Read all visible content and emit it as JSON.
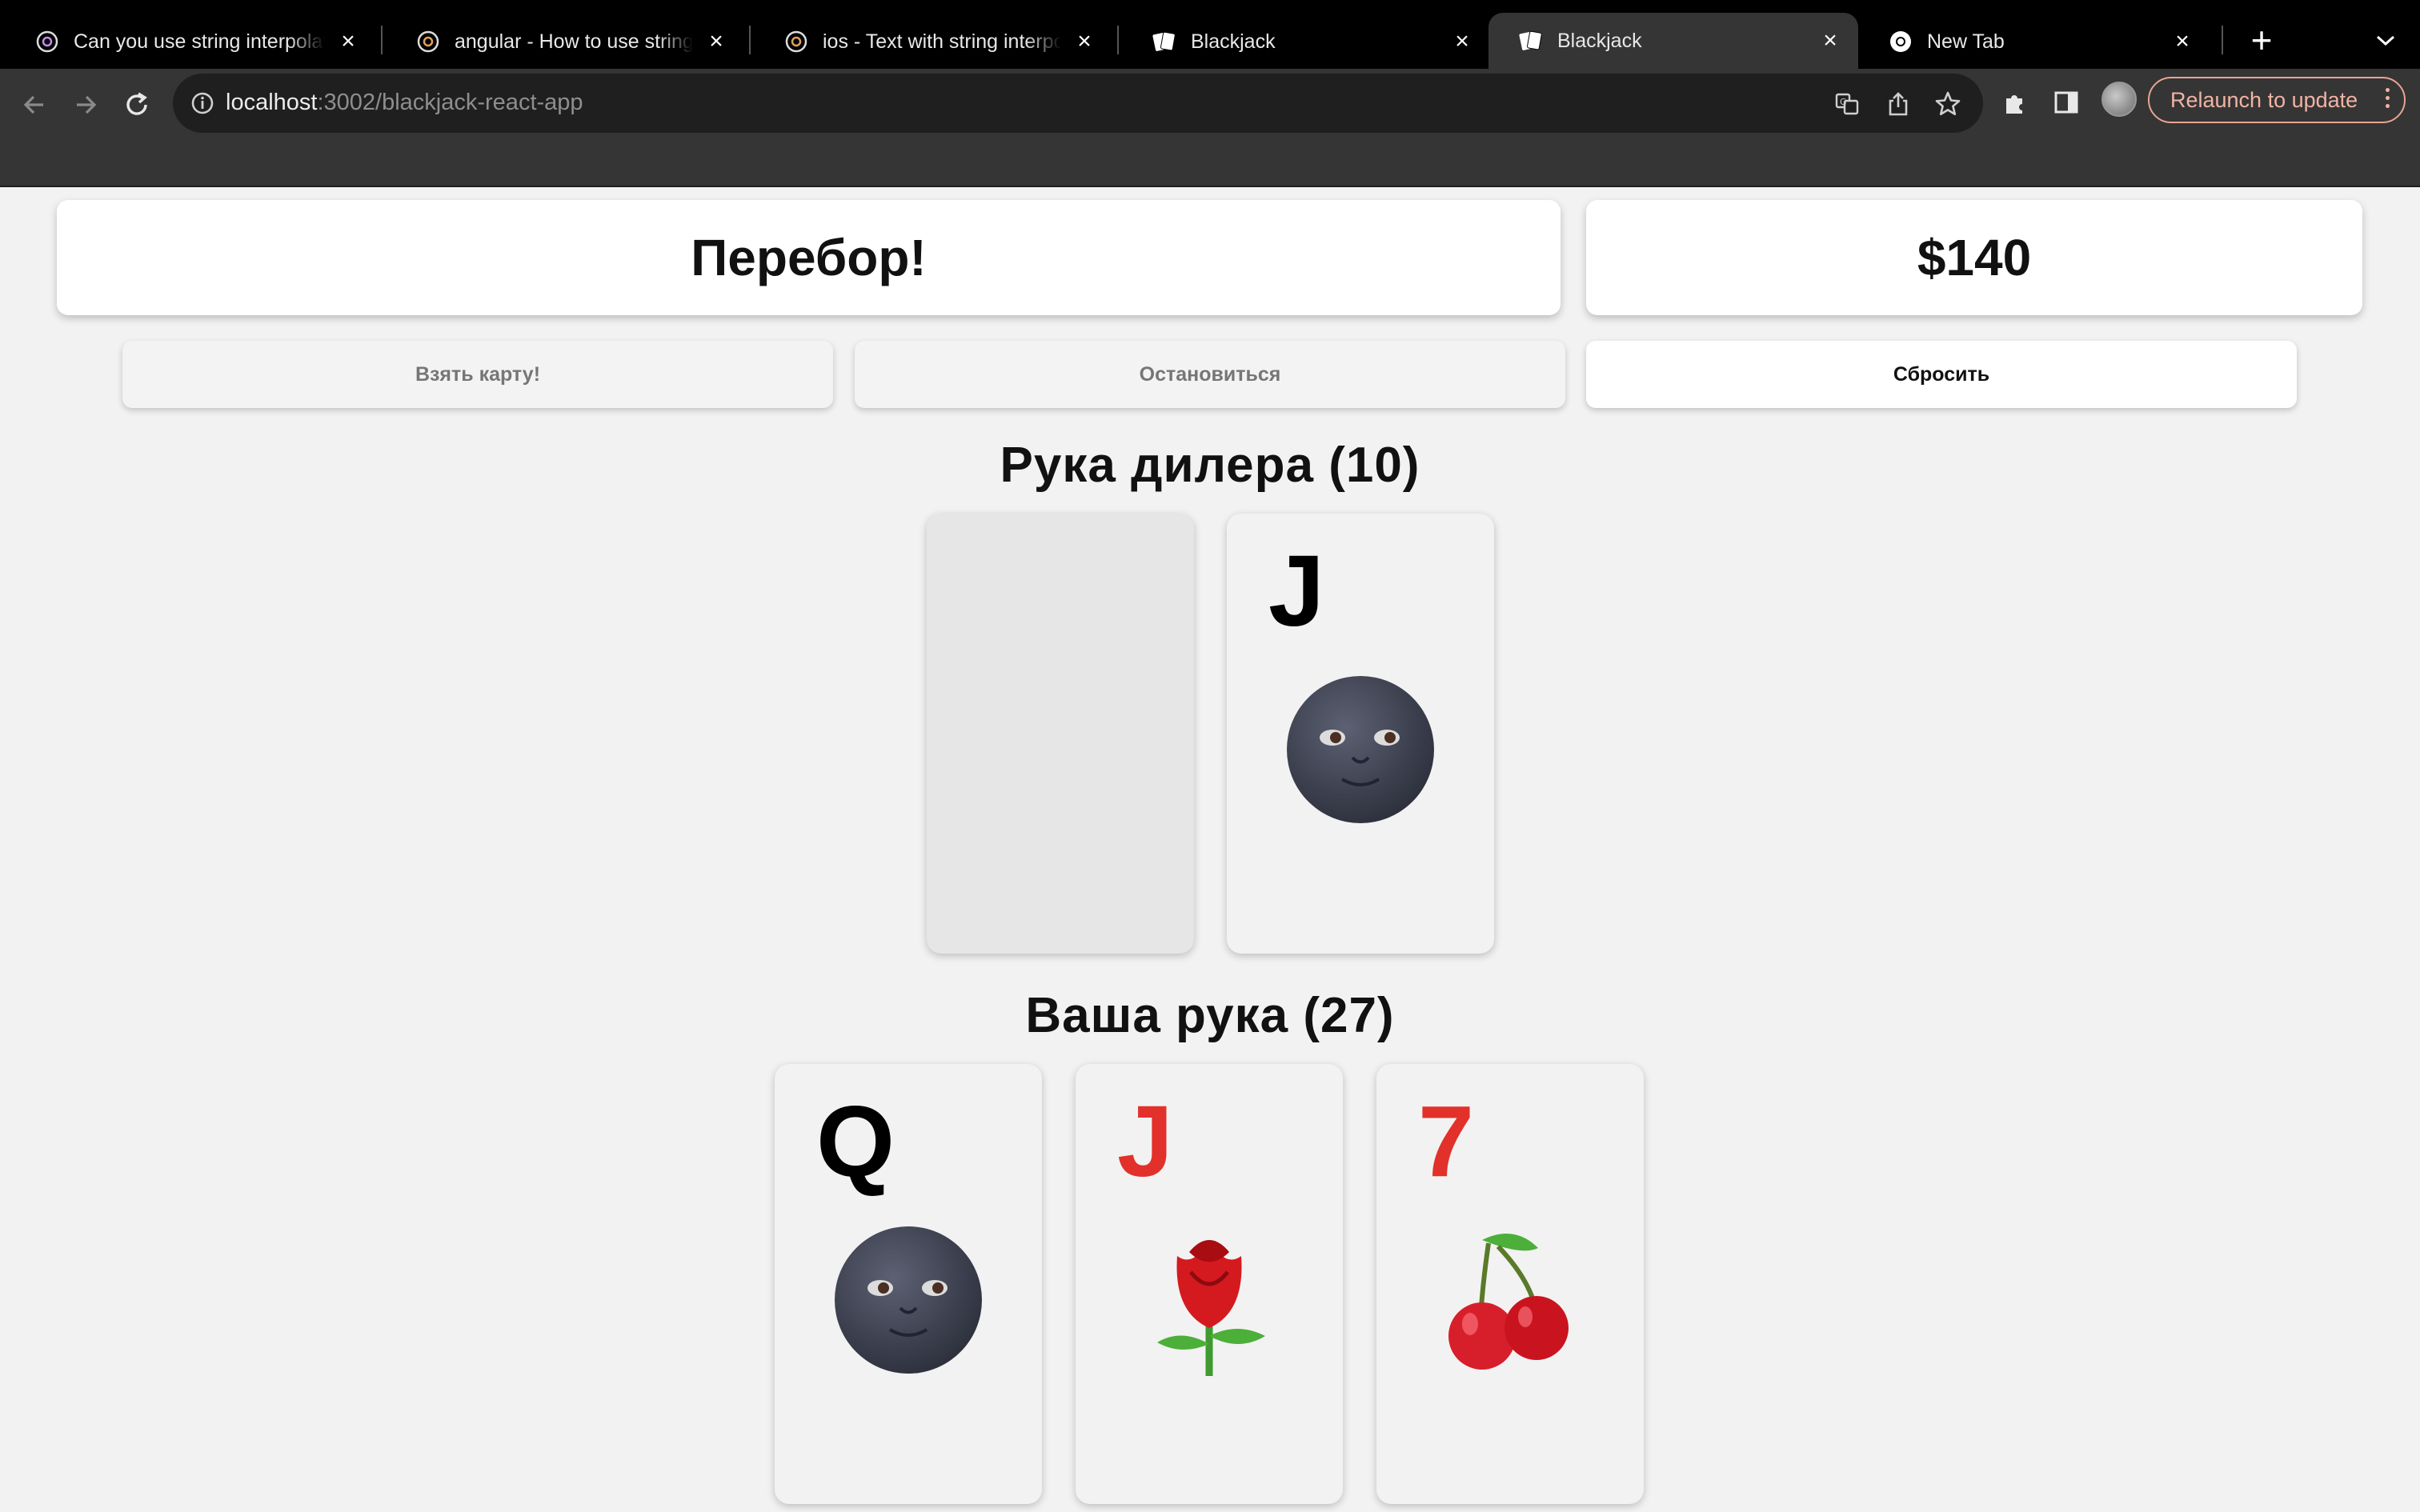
{
  "browser": {
    "tabs": [
      {
        "title": "Can you use string interpolation",
        "favicon": "chatgpt-icon",
        "active": false
      },
      {
        "title": "angular - How to use string interpolation",
        "favicon": "chatgpt-icon",
        "active": false
      },
      {
        "title": "ios - Text with string interpolation",
        "favicon": "chatgpt-icon",
        "active": false
      },
      {
        "title": "Blackjack",
        "favicon": "cards-icon",
        "active": false
      },
      {
        "title": "Blackjack",
        "favicon": "cards-icon",
        "active": true
      },
      {
        "title": "New Tab",
        "favicon": "chrome-icon",
        "active": false
      }
    ],
    "url_host": "localhost",
    "url_path": ":3002/blackjack-react-app",
    "relaunch_label": "Relaunch to update",
    "relaunch_color": "#f2b3a3"
  },
  "game": {
    "status": "Перебор!",
    "balance": "$140",
    "buttons": {
      "hit": "Взять карту!",
      "stand": "Остановиться",
      "reset": "Сбросить"
    },
    "dealer_title": "Рука дилера (10)",
    "player_title": "Ваша рука (27)",
    "dealer_cards": [
      {
        "face_down": true,
        "rank": "",
        "suit": "",
        "color": ""
      },
      {
        "face_down": false,
        "rank": "J",
        "suit": "new-moon-face",
        "color": "black"
      }
    ],
    "player_cards": [
      {
        "face_down": false,
        "rank": "Q",
        "suit": "new-moon-face",
        "color": "black"
      },
      {
        "face_down": false,
        "rank": "J",
        "suit": "rose",
        "color": "red"
      },
      {
        "face_down": false,
        "rank": "7",
        "suit": "cherries",
        "color": "red"
      }
    ],
    "colors": {
      "red": "#e2312a",
      "black": "#000000"
    }
  }
}
